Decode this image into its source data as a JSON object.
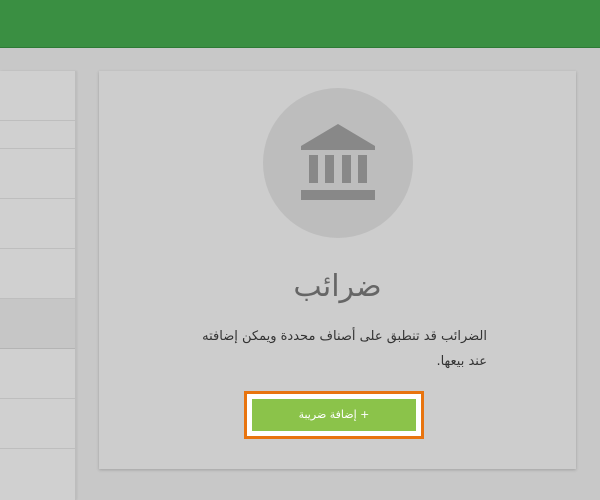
{
  "header": {
    "color": "#3a8f42"
  },
  "sidebar": {
    "items": [
      {
        "label": ""
      },
      {
        "label": ""
      },
      {
        "label": ""
      },
      {
        "label": ""
      },
      {
        "label": ""
      },
      {
        "label": "",
        "active": true
      },
      {
        "label": ""
      },
      {
        "label": ""
      }
    ]
  },
  "empty_state": {
    "icon": "bank-icon",
    "title": "ضرائب",
    "description": "الضرائب قد تنطبق على أصناف محددة ويمكن إضافته عند بيعها.",
    "add_button_label": "+ إضافة ضريبة",
    "add_button_color": "#8bc34a",
    "highlight_color": "#e8740f"
  }
}
